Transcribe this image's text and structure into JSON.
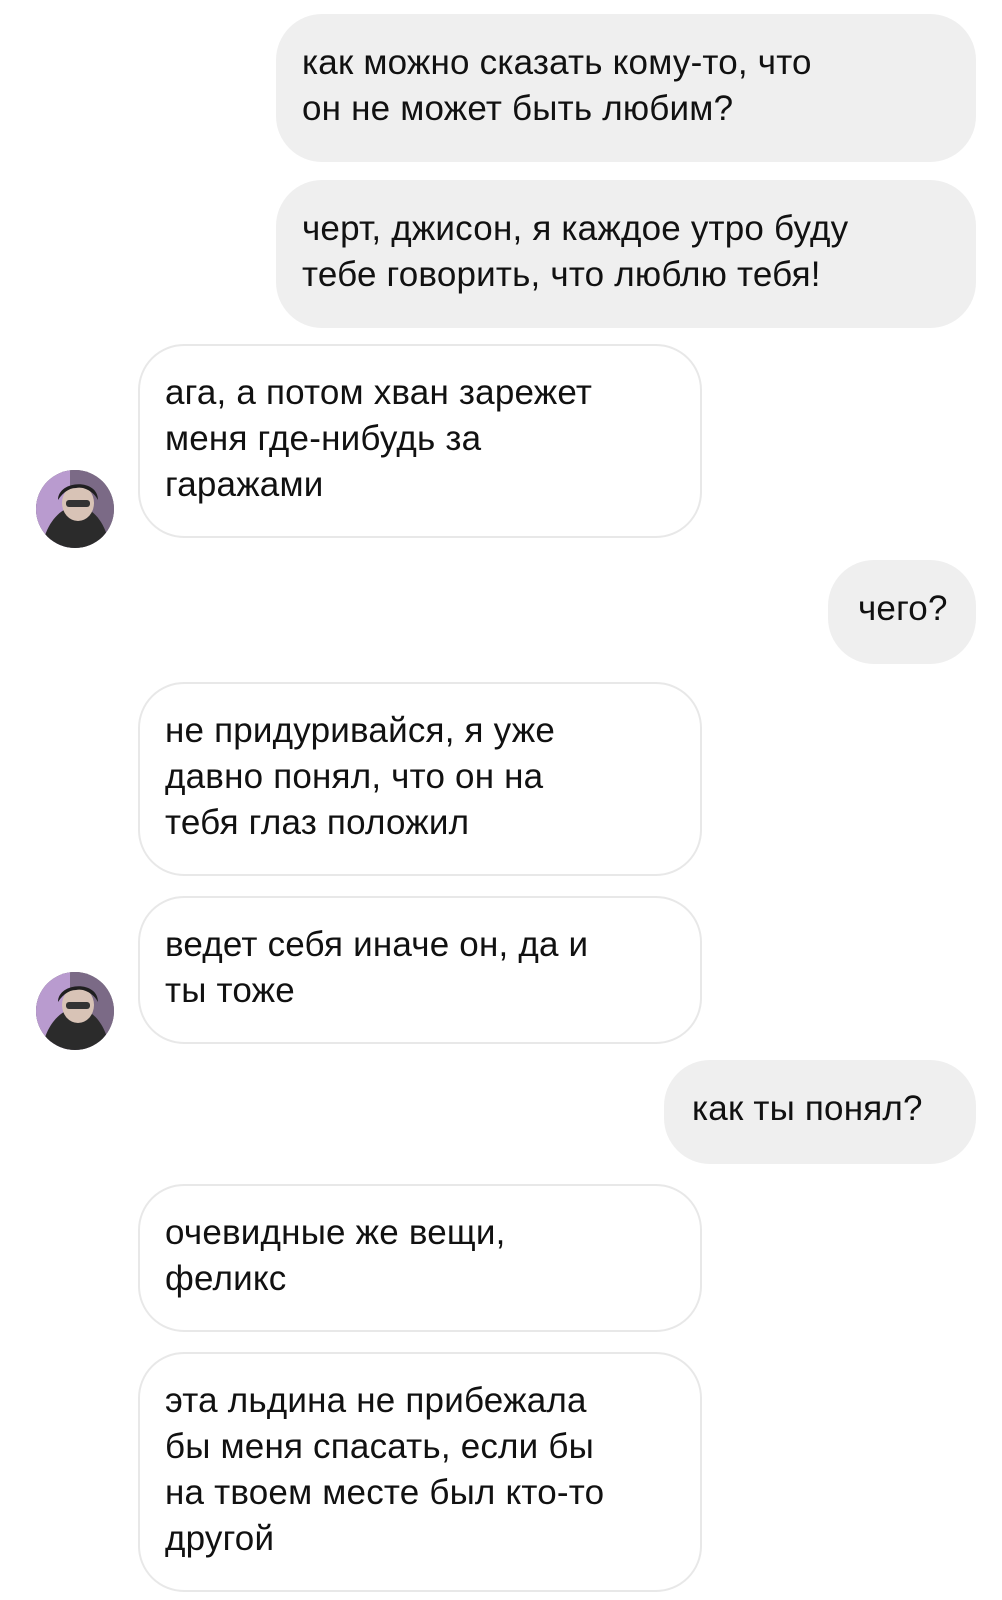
{
  "messages": [
    {
      "id": "m1",
      "side": "out",
      "text": "как можно сказать кому-то, что\nон не может быть любим?"
    },
    {
      "id": "m2",
      "side": "out",
      "text": "черт, джисон, я каждое утро буду\nтебе говорить, что люблю тебя!"
    },
    {
      "id": "m3",
      "side": "in",
      "text": "ага, а потом хван зарежет\nменя где-нибудь за\nгаражами"
    },
    {
      "id": "m4",
      "side": "out",
      "text": "чего?"
    },
    {
      "id": "m5",
      "side": "in",
      "text": "не придуривайся, я уже\nдавно понял, что он на\nтебя глаз положил"
    },
    {
      "id": "m6",
      "side": "in",
      "text": "ведет себя иначе он, да и\nты тоже"
    },
    {
      "id": "m7",
      "side": "out",
      "text": "как ты понял?"
    },
    {
      "id": "m8",
      "side": "in",
      "text": "очевидные же вещи,\nфеликс"
    },
    {
      "id": "m9",
      "side": "in",
      "text": "эта льдина не прибежала\nбы меня спасать, если бы\nна твоем месте был кто-то\nдругой"
    }
  ],
  "avatar": {
    "icon": "contact-avatar-photo"
  },
  "colors": {
    "outgoing_bubble": "#efefef",
    "incoming_border": "#e8e8e8",
    "text": "#111111",
    "background": "#ffffff"
  }
}
